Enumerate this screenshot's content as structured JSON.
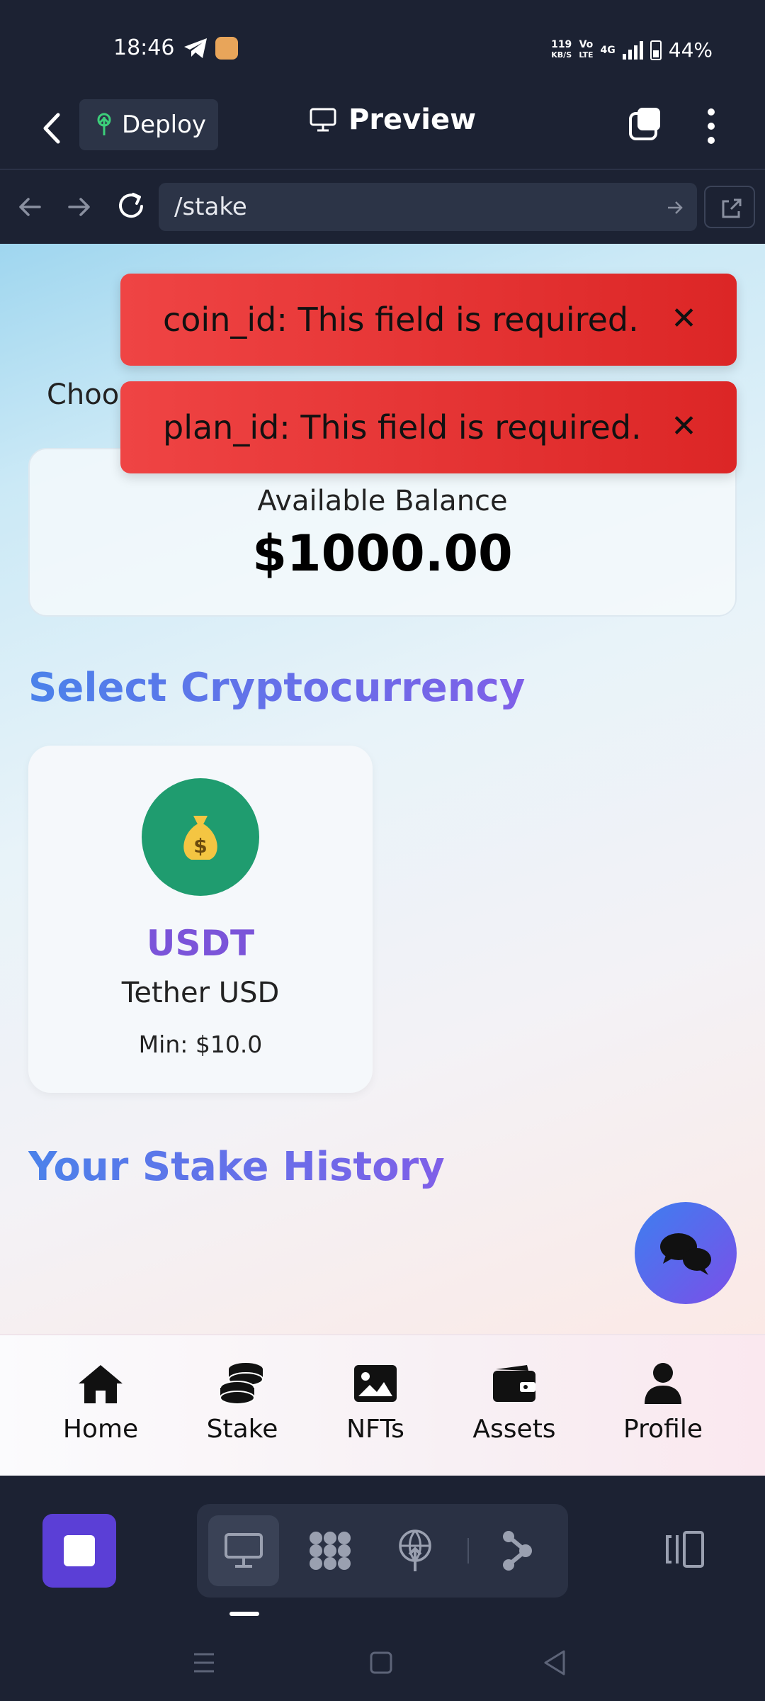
{
  "status_bar": {
    "time": "18:46",
    "net_speed_top": "119",
    "net_speed_bottom": "KB/S",
    "volte_top": "Vo",
    "volte_bottom": "LTE",
    "network": "4G",
    "battery": "44%",
    "icons": [
      "telegram-icon",
      "app-notification-icon",
      "signal-icon",
      "battery-icon"
    ]
  },
  "app_bar": {
    "deploy_label": "Deploy",
    "title": "Preview",
    "icons": [
      "back-icon",
      "deploy-icon",
      "monitor-icon",
      "tabs-icon",
      "more-icon"
    ]
  },
  "url_bar": {
    "url": "/stake",
    "icons": [
      "nav-back-icon",
      "nav-forward-icon",
      "reload-icon",
      "go-arrow-icon",
      "open-external-icon"
    ]
  },
  "page": {
    "choose_partial": "Choo",
    "balance_label": "Available Balance",
    "balance_value": "$1000.00",
    "select_title": "Select Cryptocurrency",
    "coin": {
      "icon": "money-bag-icon",
      "symbol": "USDT",
      "name": "Tether USD",
      "min": "Min: $10.0",
      "icon_color": "#1f9c6f"
    },
    "history_title": "Your Stake History"
  },
  "toasts": [
    {
      "text": "coin_id: This field is required.",
      "close": "✕"
    },
    {
      "text": "plan_id: This field is required.",
      "close": "✕"
    }
  ],
  "bottom_nav": [
    {
      "label": "Home",
      "icon": "home-icon"
    },
    {
      "label": "Stake",
      "icon": "coins-icon"
    },
    {
      "label": "NFTs",
      "icon": "image-icon"
    },
    {
      "label": "Assets",
      "icon": "wallet-icon"
    },
    {
      "label": "Profile",
      "icon": "user-icon"
    }
  ],
  "toolbar": {
    "icons": [
      "stop-icon",
      "desktop-icon",
      "grid-icon",
      "globe-deploy-icon",
      "share-icon",
      "layout-icon"
    ]
  },
  "colors": {
    "toast": "#ef4444",
    "accent_gradient_start": "#4b82ea",
    "accent_gradient_end": "#7f5fe8",
    "chrome_bg": "#1c2233",
    "coin_symbol": "#7b54d9"
  }
}
